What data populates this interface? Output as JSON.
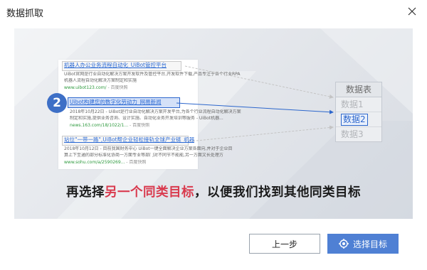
{
  "window": {
    "title": "数据抓取",
    "close_icon": "close-icon"
  },
  "illustration": {
    "results": [
      {
        "title": "机器人办公业务流程自动化_UiBot管控平台",
        "snippet1": "UiBot官网是行业自动化解决方案开发软件及管控平台,开发软件下载,产品专注于各个行业RPA",
        "snippet2": "机器人流程自动化解决方案制定和实施",
        "url": "www.uibot123.com/",
        "url_suffix": " - 百度快照"
      },
      {
        "title": "Uibot构建您的数字化劳动力_网易新闻",
        "snippet1_date": "2018年10月22日",
        "snippet1": " - UiBot是行业自动化解决方案开发平台,为各个行业流程自动化解决方案",
        "snippet2": "制定和实施,提供业务咨询、设计实施、自动化业务开发培训等服务 - UiBot机器...",
        "url": "news.163.com/18/1022/1...",
        "url_suffix": " - 百度快照"
      },
      {
        "title": "站位\"一带一路\",UiBot帮企业轻松接轨全球产业链_机器",
        "snippet1_date": "2018年10月12日",
        "snippet1": " - 目前我国财务中心 UiBot一键全面解决企业方案各面向,并对于企业目",
        "snippet2": "算上下至通的部分标准化协商一方面专业等部门对不同节不能能,另一方面文长处理方",
        "url": "www.sohu.com/a/2590269...",
        "url_suffix": " - 百度快照"
      }
    ],
    "step_number": "2",
    "table": {
      "header": "数据表",
      "rows": [
        "数据1",
        "数据2",
        "数据3"
      ],
      "selected_index": 1
    },
    "caption": {
      "part1": "再选择",
      "highlight": "另一个同类目标",
      "part2": "，以便我们找到其他同类目标"
    }
  },
  "footer": {
    "prev_label": "上一步",
    "select_label": "选择目标",
    "select_icon": "target-icon"
  },
  "colors": {
    "primary_button": "#4f80d4",
    "highlight_text": "#d93a4e",
    "badge": "#3d6fc6"
  }
}
